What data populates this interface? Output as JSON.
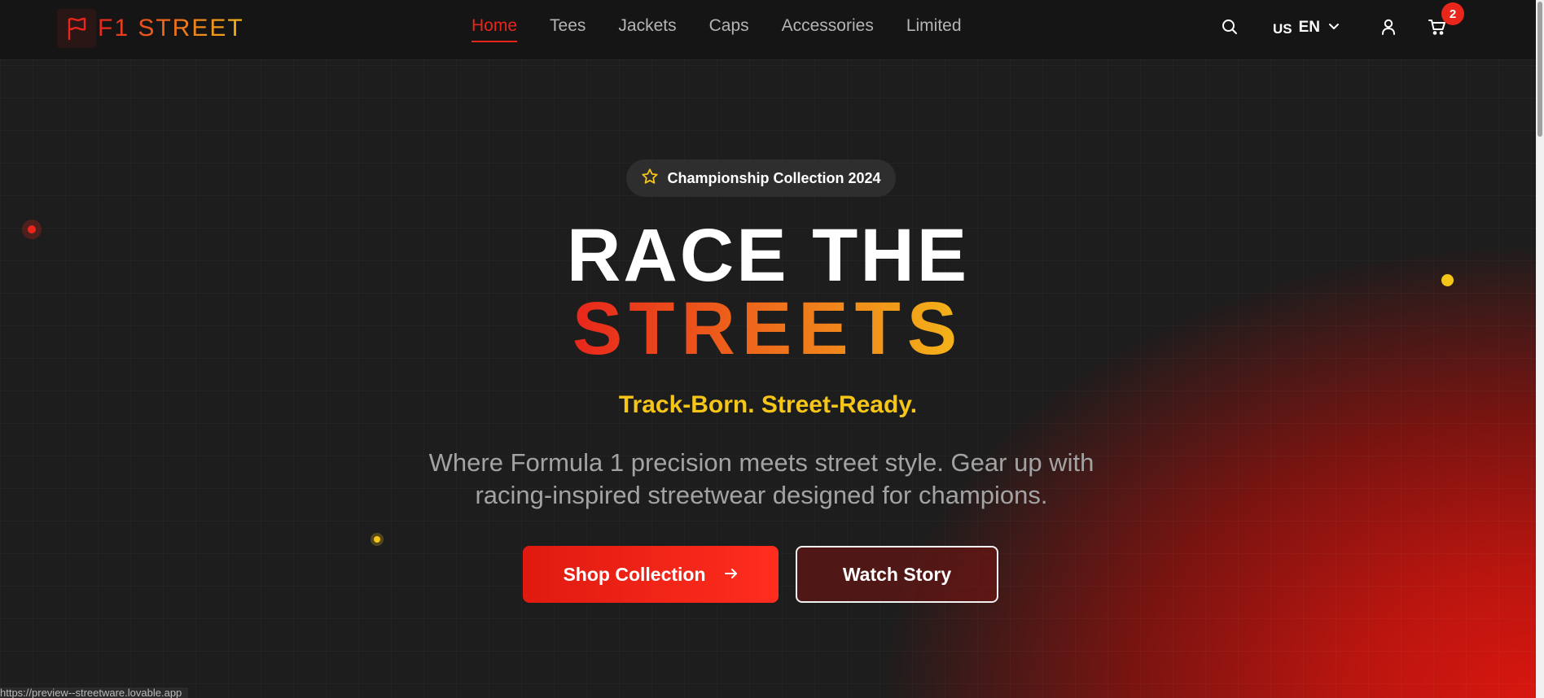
{
  "brand": {
    "name": "F1 STREET"
  },
  "nav": {
    "items": [
      {
        "label": "Home",
        "active": true
      },
      {
        "label": "Tees"
      },
      {
        "label": "Jackets"
      },
      {
        "label": "Caps"
      },
      {
        "label": "Accessories"
      },
      {
        "label": "Limited"
      }
    ]
  },
  "header": {
    "language": {
      "flag": "US",
      "code": "EN"
    },
    "cart_count": "2",
    "icons": [
      "search-icon",
      "chevron-down-icon",
      "user-icon",
      "cart-icon"
    ]
  },
  "hero": {
    "badge": "Championship Collection 2024",
    "title_line1": "RACE THE",
    "title_line2": "STREETS",
    "tagline": "Track-Born. Street-Ready.",
    "description": "Where Formula 1 precision meets street style. Gear up with racing-inspired streetwear designed for champions.",
    "primary_button": "Shop Collection",
    "secondary_button": "Watch Story"
  },
  "status_bar": {
    "url": "https://preview--streetware.lovable.app"
  },
  "colors": {
    "accent_red": "#e8261c",
    "accent_yellow": "#f5c518",
    "background": "#1d1d1d"
  }
}
